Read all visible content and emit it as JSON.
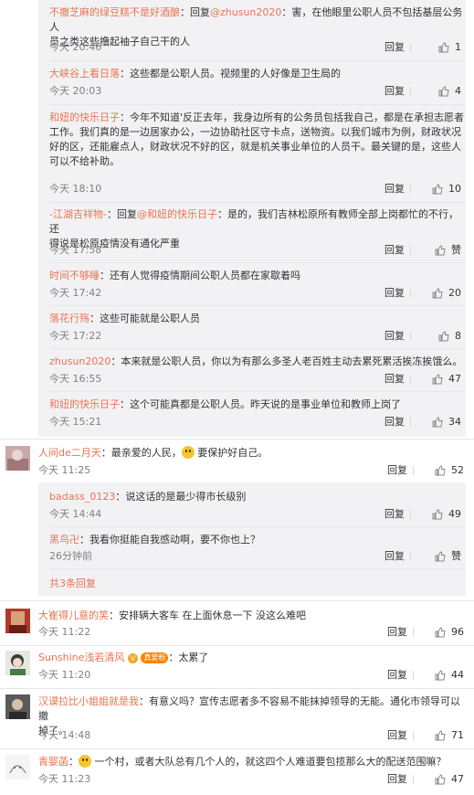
{
  "replies_a": [
    {
      "name": "不撤芝麻的绿豆糕不是好酒酿",
      "prefix": "：回复",
      "mention": "@zhusun2020",
      "text_line1": "：害，在他眼里公职人员不包括基层公务人",
      "text_line2": "员之类这些撸起袖子自己干的人",
      "time": "今天 20:46",
      "reply": "回复",
      "likes": "1"
    },
    {
      "name": "大峡谷上看日落",
      "text": "：这些都是公职人员。视频里的人好像是卫生局的",
      "time": "今天 20:03",
      "reply": "回复",
      "likes": "4"
    },
    {
      "name": "和妞的快乐日子",
      "text_line1": "：今年不知道'反正去年，我身边所有的公务员包括我自己，都是在承担志愿者",
      "text_line2": "工作。我们真的是一边居家办公，一边协助社区守卡点，送物资。以我们城市为例，财政状况",
      "text_line3": "好的区，还能雇点人，财政状况不好的区，就是机关事业单位的人员干。最关键的是，这些人",
      "text_line4": "可以不给补助。",
      "time": "今天 18:10",
      "reply": "回复",
      "likes": "10"
    },
    {
      "name": "-江湖吉祥物-",
      "prefix": "：回复",
      "mention": "@和妞的快乐日子",
      "text_line1": "：是的，我们吉林松原所有教师全部上岗都忙的不行，还",
      "text_line2": "得说是松原疫情没有通化严重",
      "time": "今天 17:58",
      "reply": "回复",
      "likes": "赞"
    },
    {
      "name": "时间不够睡",
      "text": "：还有人觉得疫情期间公职人员都在家歇着吗",
      "time": "今天 17:42",
      "reply": "回复",
      "likes": "20"
    },
    {
      "name": "落花行殇",
      "text": "：这些可能就是公职人员",
      "time": "今天 17:22",
      "reply": "回复",
      "likes": "8"
    },
    {
      "name": "zhusun2020",
      "text": "：本来就是公职人员，你以为有那么多圣人老百姓主动去累死累活挨冻挨饿么。",
      "time": "今天 16:55",
      "reply": "回复",
      "likes": "47"
    },
    {
      "name": "和妞的快乐日子",
      "text": "：这个可能真都是公职人员。昨天说的是事业单位和教师上岗了",
      "time": "今天 15:21",
      "reply": "回复",
      "likes": "34"
    }
  ],
  "comment_1": {
    "name": "人间de二月天",
    "text": "：最亲爱的人民，",
    "text_after": " 要保护好自己。",
    "time": "今天 11:25",
    "reply": "回复",
    "likes": "52"
  },
  "replies_b": [
    {
      "name": "badass_0123",
      "text": "：说这话的是最少得市长级别",
      "time": "今天 14:44",
      "reply": "回复",
      "likes": "49"
    },
    {
      "name": "黑鸟卍",
      "text": "：我看你挺能自我感动啊，要不你也上？",
      "time": "26分钟前",
      "reply": "回复",
      "likes": "赞"
    }
  ],
  "more_replies": "共3条回复",
  "comments": [
    {
      "name": "大崔得儿意的笑",
      "text": "：安排辆大客车 在上面休息一下 没这么难吧",
      "time": "今天 11:22",
      "reply": "回复",
      "likes": "96"
    },
    {
      "name": "Sunshine浅若清风",
      "badge": "真爱粉",
      "text": "：太累了",
      "time": "今天 11:20",
      "reply": "回复",
      "likes": "44"
    },
    {
      "name": "汉谟拉比小姐姐就是我",
      "text_line1": "：有意义吗？宣传志愿者多不容易不能抹掉领导的无能。通化市领导可以撤",
      "text_line2": "掉了。",
      "time": "今天 14:48",
      "reply": "回复",
      "likes": "71"
    },
    {
      "name": "青婴菡",
      "text": " 一个村，或者大队总有几个人的，就这四个人难道要包揽那么大的配送范围嘛？",
      "time": "今天 11:23",
      "reply": "回复",
      "likes": "47"
    }
  ],
  "icons": {
    "like": "thumbs-up-icon",
    "emoji": "smile-emoji-icon",
    "vip": "vip-icon"
  },
  "colors": {
    "name": "#eb7350",
    "meta": "#808080",
    "reply_bg": "#f2f2f5"
  }
}
